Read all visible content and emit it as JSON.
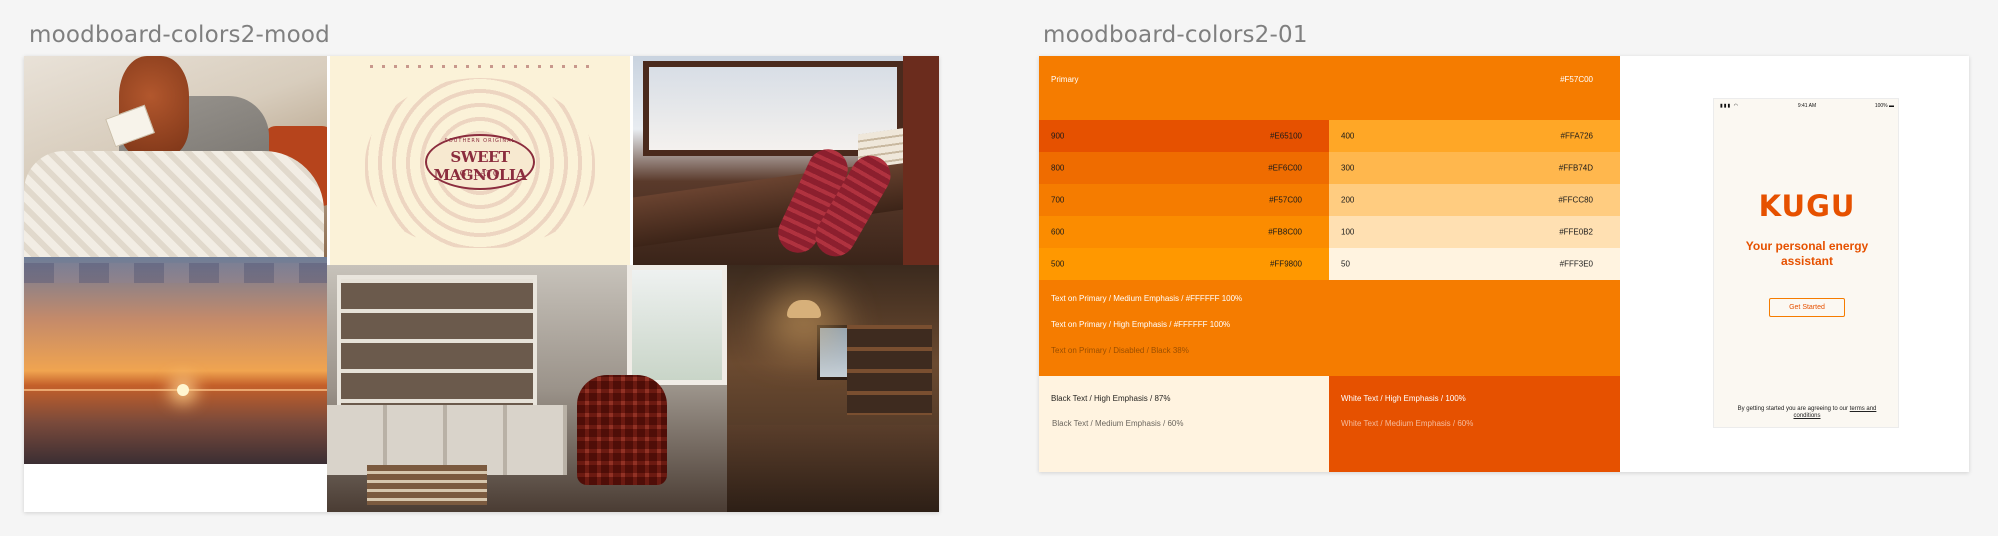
{
  "mood_frame": {
    "title": "moodboard-colors2-mood"
  },
  "gelato_image": {
    "brand": "SWEET MAGNOLIA",
    "sub": "GELATO",
    "top": "SOUTHERN ORIGINAL"
  },
  "colors_frame": {
    "title": "moodboard-colors2-01",
    "primary": {
      "label": "Primary",
      "hex": "#F57C00"
    },
    "swatches_left": [
      {
        "label": "900",
        "hex": "#E65100"
      },
      {
        "label": "800",
        "hex": "#EF6C00"
      },
      {
        "label": "700",
        "hex": "#F57C00"
      },
      {
        "label": "600",
        "hex": "#FB8C00"
      },
      {
        "label": "500",
        "hex": "#FF9800"
      }
    ],
    "swatches_right": [
      {
        "label": "400",
        "hex": "#FFA726"
      },
      {
        "label": "300",
        "hex": "#FFB74D"
      },
      {
        "label": "200",
        "hex": "#FFCC80"
      },
      {
        "label": "100",
        "hex": "#FFE0B2"
      },
      {
        "label": "50",
        "hex": "#FFF3E0"
      }
    ],
    "text_on_primary": {
      "medium": "Text on Primary / Medium Emphasis / #FFFFFF 100%",
      "high": "Text on Primary / High Emphasis / #FFFFFF 100%",
      "disabled": "Text on Primary / Disabled / Black 38%"
    },
    "black_text": {
      "high": "Black Text / High Emphasis / 87%",
      "medium": "Black Text / Medium Emphasis / 60%"
    },
    "white_text": {
      "high": "White Text / High Emphasis / 100%",
      "medium": "White Text / Medium Emphasis / 60%"
    }
  },
  "phone": {
    "time": "9:41 AM",
    "battery": "100%",
    "logo": "KUGU",
    "tagline": "Your personal energy assistant",
    "cta": "Get Started",
    "legal_prefix": "By getting started you are agreeing to our",
    "legal_link": "terms and conditions"
  },
  "colors": {
    "accent": "#F57C00",
    "dark": "#E65100",
    "light": "#FFF3E0"
  }
}
